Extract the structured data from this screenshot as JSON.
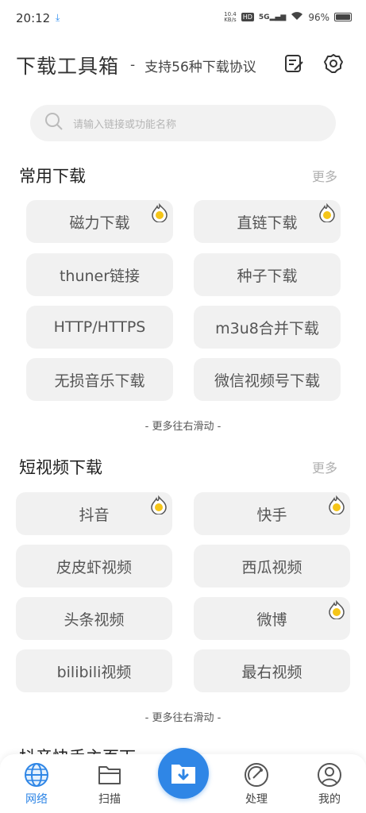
{
  "status": {
    "time": "20:12",
    "net_speed_value": "10.4",
    "net_speed_unit": "KB/s",
    "hd": "HD",
    "network": "5G",
    "battery": "96%"
  },
  "header": {
    "title": "下载工具箱",
    "separator": "-",
    "subtitle": "支持56种下载协议"
  },
  "search": {
    "placeholder": "请输入链接或功能名称"
  },
  "sections": [
    {
      "title": "常用下载",
      "more": "更多",
      "items": [
        {
          "label": "磁力下载",
          "hot": true
        },
        {
          "label": "直链下载",
          "hot": true
        },
        {
          "label": "thuner链接",
          "hot": false
        },
        {
          "label": "种子下载",
          "hot": false
        },
        {
          "label": "HTTP/HTTPS",
          "hot": false
        },
        {
          "label": "m3u8合并下载",
          "hot": false
        },
        {
          "label": "无损音乐下载",
          "hot": false
        },
        {
          "label": "微信视频号下载",
          "hot": false
        }
      ],
      "hint": "- 更多往右滑动 -"
    },
    {
      "title": "短视频下载",
      "more": "更多",
      "items": [
        {
          "label": "抖音",
          "hot": true
        },
        {
          "label": "快手",
          "hot": true
        },
        {
          "label": "皮皮虾视频",
          "hot": false
        },
        {
          "label": "西瓜视频",
          "hot": false
        },
        {
          "label": "头条视频",
          "hot": false
        },
        {
          "label": "微博",
          "hot": true
        },
        {
          "label": "bilibili视频",
          "hot": false
        },
        {
          "label": "最右视频",
          "hot": false
        }
      ],
      "hint": "- 更多往右滑动 -"
    }
  ],
  "partial_section_title": "抖音快手主页下",
  "tabs": [
    {
      "label": "网络",
      "icon": "globe-icon",
      "active": true
    },
    {
      "label": "扫描",
      "icon": "folder-icon",
      "active": false
    },
    {
      "label": "处理",
      "icon": "satellite-icon",
      "active": false
    },
    {
      "label": "我的",
      "icon": "user-icon",
      "active": false
    }
  ],
  "colors": {
    "accent": "#2f86e6",
    "button_bg": "#f1f1f1",
    "hot_badge": "#f5c518"
  }
}
